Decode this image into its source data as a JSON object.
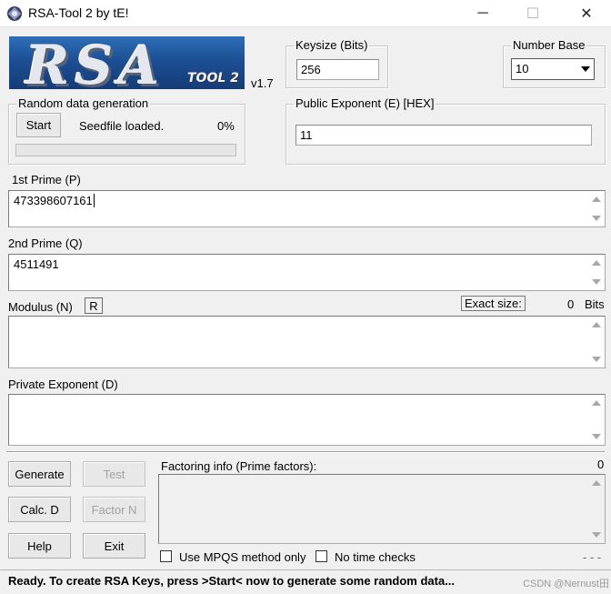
{
  "window": {
    "title": "RSA-Tool 2 by tE!",
    "icon": "app-icon",
    "controls": {
      "minimize": "─",
      "maximize": "☐",
      "close": "✕"
    }
  },
  "logo": {
    "word": "RSA",
    "sub": "TOOL 2"
  },
  "version": "v1.7",
  "keysize": {
    "label": "Keysize (Bits)",
    "value": "256"
  },
  "number_base": {
    "label": "Number Base",
    "value": "10"
  },
  "random": {
    "label": "Random data generation",
    "start_label": "Start",
    "status": "Seedfile loaded.",
    "percent": "0%",
    "progress": 0
  },
  "public_exponent": {
    "label": "Public Exponent (E) [HEX]",
    "value": "11"
  },
  "prime_p": {
    "label": "1st Prime (P)",
    "value": "473398607161"
  },
  "prime_q": {
    "label": "2nd Prime (Q)",
    "value": "4511491"
  },
  "modulus": {
    "label": "Modulus (N)",
    "r_label": "R",
    "exact_size_label": "Exact size:",
    "exact_size_value": "0",
    "bits_label": "Bits",
    "value": ""
  },
  "private_exponent": {
    "label": "Private Exponent (D)",
    "value": ""
  },
  "buttons": {
    "generate": "Generate",
    "test": "Test",
    "calc_d": "Calc. D",
    "factor_n": "Factor N",
    "help": "Help",
    "exit": "Exit"
  },
  "factoring": {
    "label": "Factoring info (Prime factors):",
    "count": "0",
    "mpqs_label": "Use MPQS method only",
    "notime_label": "No time checks",
    "dashes": "- - -"
  },
  "status": {
    "text": "Ready. To create RSA Keys, press >Start< now to generate some random data...",
    "watermark": "CSDN @Nernust田"
  },
  "colors": {
    "window_bg": "#f0f0f0",
    "logo_blue": "#1d4f95",
    "progress_green": "#06b025"
  }
}
